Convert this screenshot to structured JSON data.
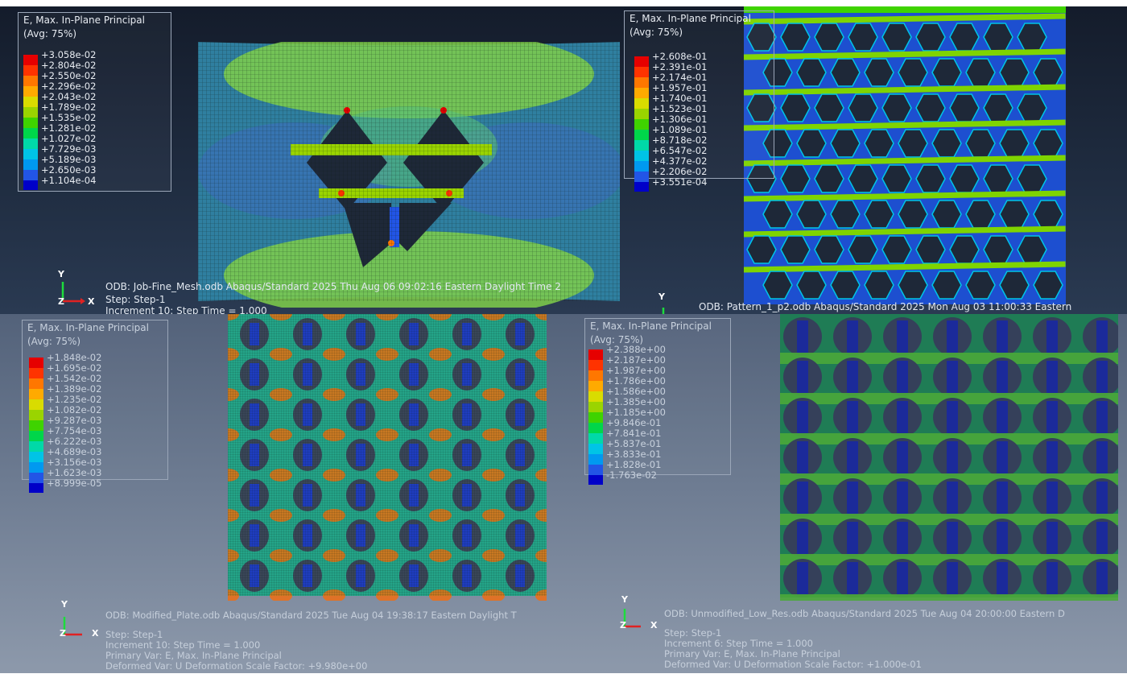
{
  "legend_colors": [
    "#e60000",
    "#ff3300",
    "#ff7700",
    "#ffaa00",
    "#d9dc00",
    "#9ad400",
    "#3fd300",
    "#00d64a",
    "#00d9a8",
    "#00c4e6",
    "#0099f0",
    "#2255e6",
    "#0000c8"
  ],
  "panels": [
    {
      "legend_title": "E, Max. In-Plane Principal",
      "legend_avg": "(Avg: 75%)",
      "legend_values": [
        "+3.058e-02",
        "+2.804e-02",
        "+2.550e-02",
        "+2.296e-02",
        "+2.043e-02",
        "+1.789e-02",
        "+1.535e-02",
        "+1.281e-02",
        "+1.027e-02",
        "+7.729e-03",
        "+5.189e-03",
        "+2.650e-03",
        "+1.104e-04"
      ],
      "odb_line": "ODB: Job-Fine_Mesh.odb    Abaqus/Standard 2025    Thu Aug 06 09:02:16 Eastern Daylight Time 2",
      "step_line": "Step: Step-1",
      "increment_line": "Increment     10: Step Time =     1.000",
      "primary_line": "",
      "deformed_line": "",
      "axis_y": "Y",
      "axis_x": "X",
      "axis_z": "Z"
    },
    {
      "legend_title": "E, Max. In-Plane Principal",
      "legend_avg": "(Avg: 75%)",
      "legend_values": [
        "+2.608e-01",
        "+2.391e-01",
        "+2.174e-01",
        "+1.957e-01",
        "+1.740e-01",
        "+1.523e-01",
        "+1.306e-01",
        "+1.089e-01",
        "+8.718e-02",
        "+6.547e-02",
        "+4.377e-02",
        "+2.206e-02",
        "+3.551e-04"
      ],
      "odb_line": "ODB: Pattern_1_p2.odb    Abaqus/Standard 2025    Mon Aug 03 11:00:33 Eastern",
      "step_line": "",
      "increment_line": "",
      "primary_line": "",
      "deformed_line": "",
      "axis_y": "Y",
      "axis_x": "",
      "axis_z": ""
    },
    {
      "legend_title": "E, Max. In-Plane Principal",
      "legend_avg": "(Avg: 75%)",
      "legend_values": [
        "+1.848e-02",
        "+1.695e-02",
        "+1.542e-02",
        "+1.389e-02",
        "+1.235e-02",
        "+1.082e-02",
        "+9.287e-03",
        "+7.754e-03",
        "+6.222e-03",
        "+4.689e-03",
        "+3.156e-03",
        "+1.623e-03",
        "+8.999e-05"
      ],
      "odb_line": "ODB: Modified_Plate.odb    Abaqus/Standard 2025    Tue Aug 04 19:38:17 Eastern Daylight T",
      "step_line": "Step: Step-1",
      "increment_line": "Increment     10: Step Time =     1.000",
      "primary_line": "Primary Var: E, Max. In-Plane Principal",
      "deformed_line": "Deformed Var: U   Deformation Scale Factor: +9.980e+00",
      "axis_y": "Y",
      "axis_x": "X",
      "axis_z": "Z"
    },
    {
      "legend_title": "E, Max. In-Plane Principal",
      "legend_avg": "(Avg: 75%)",
      "legend_values": [
        "+2.388e+00",
        "+2.187e+00",
        "+1.987e+00",
        "+1.786e+00",
        "+1.586e+00",
        "+1.385e+00",
        "+1.185e+00",
        "+9.846e-01",
        "+7.841e-01",
        "+5.837e-01",
        "+3.833e-01",
        "+1.828e-01",
        "-1.763e-02"
      ],
      "odb_line": "ODB: Unmodified_Low_Res.odb    Abaqus/Standard 2025    Tue Aug 04 20:00:00 Eastern D",
      "step_line": "Step: Step-1",
      "increment_line": "Increment     6: Step Time =     1.000",
      "primary_line": "Primary Var: E, Max. In-Plane Principal",
      "deformed_line": "Deformed Var: U   Deformation Scale Factor: +1.000e-01",
      "axis_y": "Y",
      "axis_x": "X",
      "axis_z": "Z"
    }
  ]
}
